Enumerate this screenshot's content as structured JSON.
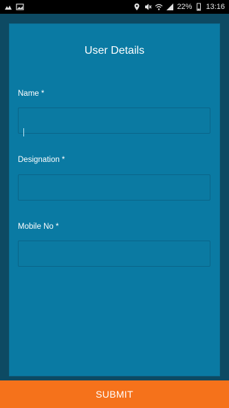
{
  "status_bar": {
    "left_icons": [
      "photo-icon",
      "image-icon"
    ],
    "right_icons": [
      "location-icon",
      "mute-icon",
      "wifi-icon",
      "signal-icon"
    ],
    "battery": "22%",
    "time": "13:16"
  },
  "form": {
    "title": "User Details",
    "fields": [
      {
        "label": "Name *",
        "value": "",
        "placeholder": ""
      },
      {
        "label": "Designation *",
        "value": "",
        "placeholder": ""
      },
      {
        "label": "Mobile No *",
        "value": "",
        "placeholder": ""
      }
    ],
    "submit_label": "SUBMIT"
  },
  "colors": {
    "background": "#0d4a63",
    "card": "#0a7aa3",
    "accent": "#f5721b",
    "status_bar": "#000000"
  }
}
